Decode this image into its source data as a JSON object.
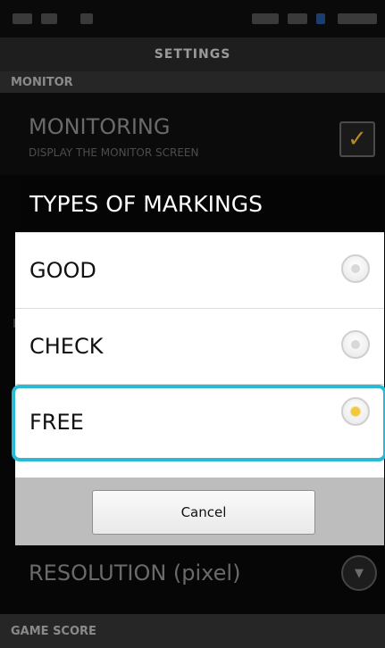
{
  "header": {
    "title": "SETTINGS"
  },
  "monitor_section": {
    "label": "MONITOR",
    "monitoring": {
      "title": "MONITORING",
      "subtitle": "DISPLAY THE MONITOR SCREEN",
      "checked": true
    }
  },
  "partial_section_letter": "M",
  "dialog": {
    "title": "TYPES OF MARKINGS",
    "options": [
      {
        "label": "GOOD",
        "selected": false
      },
      {
        "label": "CHECK",
        "selected": false
      },
      {
        "label": "FREE",
        "selected": true
      }
    ],
    "cancel_label": "Cancel"
  },
  "resolution": {
    "label": "RESOLUTION (pixel)"
  },
  "game_score_section": {
    "label": "GAME SCORE"
  },
  "colors": {
    "highlight": "#2bbad6",
    "radio_selected": "#f3c93a",
    "checkmark": "#b38a2a"
  }
}
